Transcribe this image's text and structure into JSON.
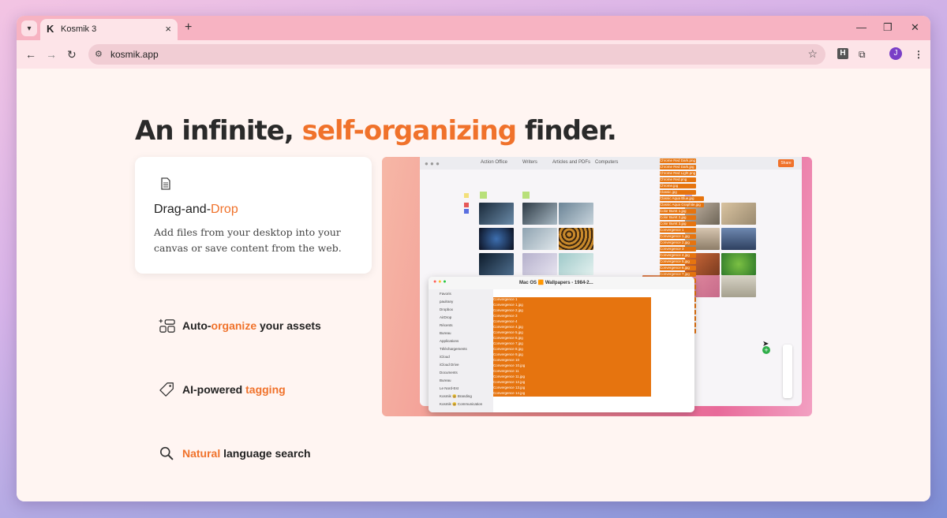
{
  "browser": {
    "tab_title": "Kosmik 3",
    "tab_close": "×",
    "new_tab": "+",
    "url": "kosmik.app",
    "profile_initial": "J",
    "extension_badge": "H",
    "window_controls": {
      "minimize": "—",
      "restore": "❐",
      "close": "✕"
    }
  },
  "hero": {
    "headline_part1": "An infinite, ",
    "headline_accent": "self-organizing",
    "headline_part2": " finder."
  },
  "feature_card": {
    "title_part1": "Drag-and-",
    "title_accent": "Drop",
    "description": "Add files from your desktop into your canvas or save content from the web."
  },
  "features": [
    {
      "pre": "Auto-",
      "accent": "organize",
      "post": " your assets"
    },
    {
      "pre": "AI-powered ",
      "accent": "tagging",
      "post": ""
    },
    {
      "pre": "",
      "accent": "Natural",
      "post": " language search"
    }
  ],
  "screenshot": {
    "toolbar_tabs": [
      "Action Office",
      "Writers",
      "Articles and PDFs",
      "Computers"
    ],
    "share_label": "Share",
    "finder_title": "Mac OS 🟧 Wallpapers - 1984-2...",
    "finder_sidebar": [
      "Favoris",
      "paulrany",
      "Dropbox",
      "AirDrop",
      "Récents",
      "Bureau",
      "Applications",
      "Téléchargements",
      "iCloud",
      "iCloud Drive",
      "Documents",
      "Bureau",
      "Le Nord-Est",
      "Kosmik 😃 Branding",
      "Kosmik 😃 Communication"
    ],
    "finder_files": [
      "Convergence 1",
      "Convergence 1.jpg",
      "Convergence 2.jpg",
      "Convergence 3",
      "Convergence 4",
      "Convergence 4.jpg",
      "Convergence 5.jpg",
      "Convergence 6.jpg",
      "Convergence 7.jpg",
      "Convergence 8.jpg",
      "Convergence 9.jpg",
      "Convergence 10",
      "Convergence 10.jpg",
      "Convergence 11",
      "Convergence 11.jpg",
      "Convergence 12.jpg",
      "Convergence 13.jpg",
      "Convergence 14.jpg"
    ],
    "dragged_files": [
      "Chrome Red Dark.png",
      "Chrome Red Dark.jpg",
      "Chrome Red Light.png",
      "Chrome Red.png",
      "Chrome.jpg",
      "Classic.jpg",
      "Classic Aqua Blue.jpg",
      "Classic Aqua Graphite.jpg",
      "Color Burst 1.jpg",
      "Color Burst 2.jpg",
      "Color Burst 3.jpg",
      "Convergence 1",
      "Convergence 1.jpg",
      "Convergence 2.jpg",
      "Convergence 3",
      "Convergence 4.jpg",
      "Convergence 5.jpg",
      "Convergence 6.jpg",
      "Convergence 7.jpg",
      "Convergence 8.jpg",
      "Convergence 9.jpg",
      "Convergence 10",
      "Convergence 10.jpg",
      "Convergence 11",
      "Convergence 11.jpg",
      "Convergence 12.jpg",
      "Convergence 13.jpg",
      "Convergence 14.jpg"
    ]
  },
  "colors": {
    "accent": "#f0722b",
    "tab_bar": "#f7b3c2"
  }
}
